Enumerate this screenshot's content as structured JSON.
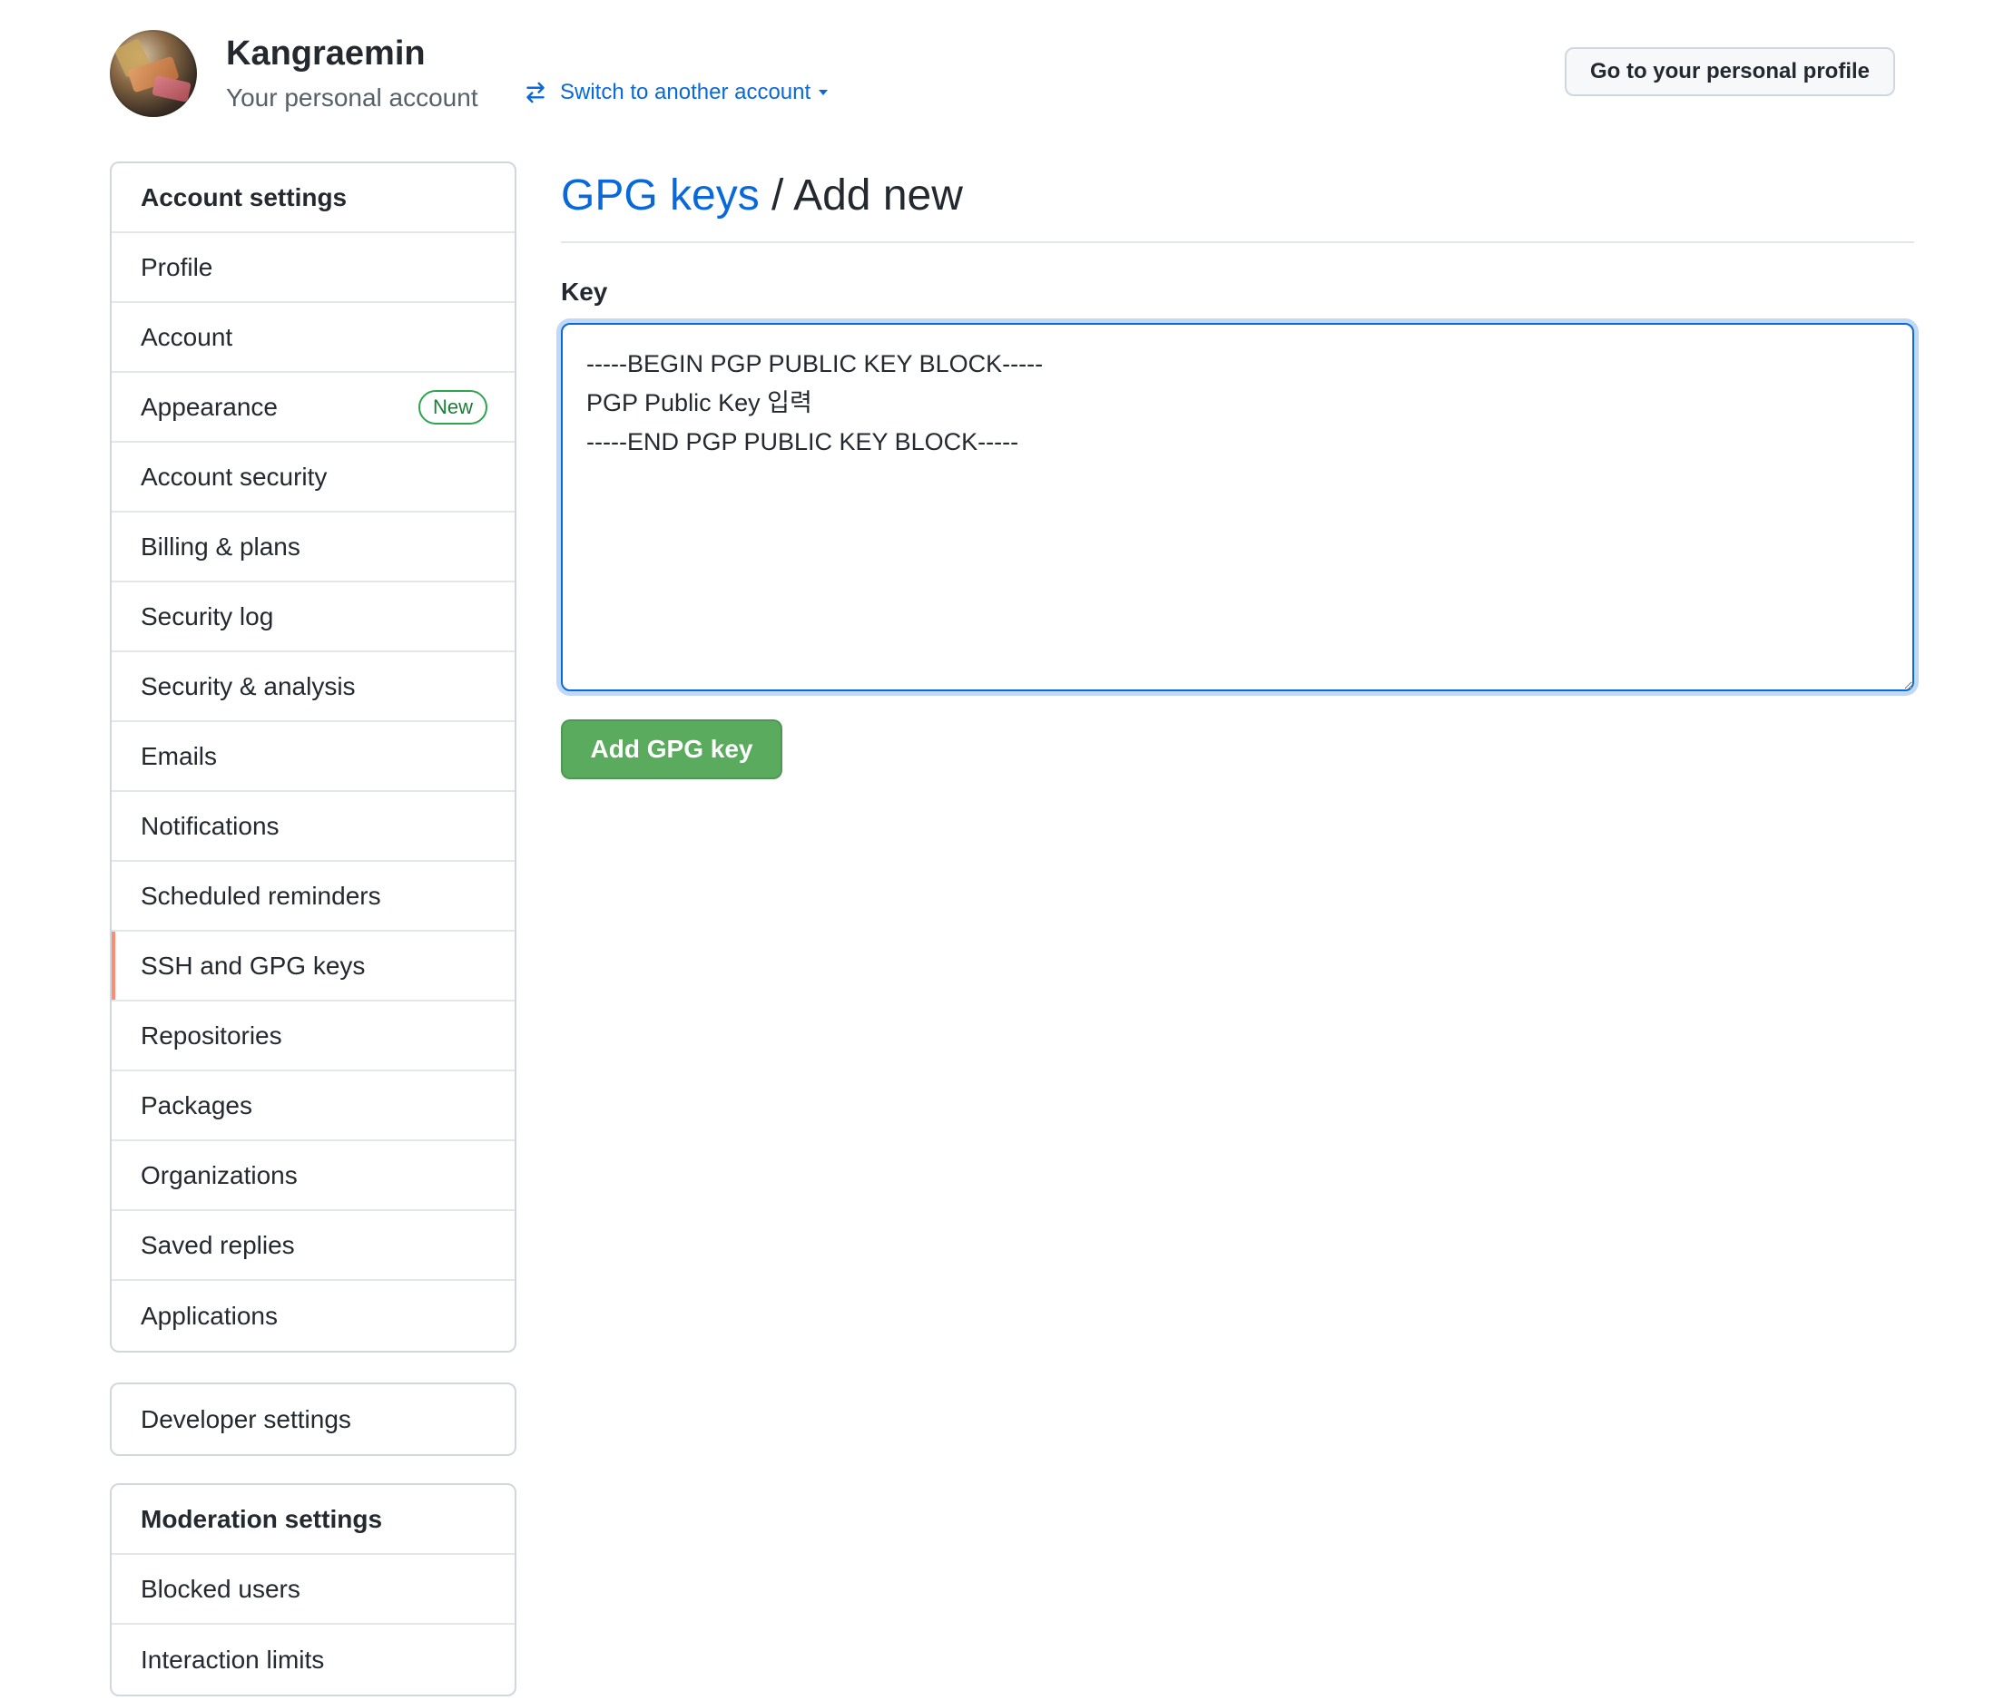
{
  "user": {
    "name": "Kangraemin",
    "subtitle": "Your personal account",
    "switch_label": "Switch to another account",
    "profile_button": "Go to your personal profile"
  },
  "sidebar": {
    "header": "Account settings",
    "items": [
      {
        "label": "Profile"
      },
      {
        "label": "Account"
      },
      {
        "label": "Appearance",
        "badge": "New"
      },
      {
        "label": "Account security"
      },
      {
        "label": "Billing & plans"
      },
      {
        "label": "Security log"
      },
      {
        "label": "Security & analysis"
      },
      {
        "label": "Emails"
      },
      {
        "label": "Notifications"
      },
      {
        "label": "Scheduled reminders"
      },
      {
        "label": "SSH and GPG keys",
        "selected": true
      },
      {
        "label": "Repositories"
      },
      {
        "label": "Packages"
      },
      {
        "label": "Organizations"
      },
      {
        "label": "Saved replies"
      },
      {
        "label": "Applications"
      }
    ]
  },
  "developer": {
    "label": "Developer settings"
  },
  "moderation": {
    "header": "Moderation settings",
    "items": [
      {
        "label": "Blocked users"
      },
      {
        "label": "Interaction limits"
      }
    ]
  },
  "main": {
    "breadcrumb_link": "GPG keys",
    "breadcrumb_separator": " / ",
    "breadcrumb_current": "Add new",
    "key_label": "Key",
    "key_value": "-----BEGIN PGP PUBLIC KEY BLOCK-----\nPGP Public Key 입력\n-----END PGP PUBLIC KEY BLOCK-----",
    "submit_label": "Add GPG key"
  },
  "colors": {
    "accent": "#0969da",
    "success": "#5aab5e",
    "selected_marker": "#fd8c73",
    "badge": "#1a7f37"
  },
  "icons": {
    "switch": "arrow-switch-icon",
    "dropdown": "triangle-down-icon"
  }
}
